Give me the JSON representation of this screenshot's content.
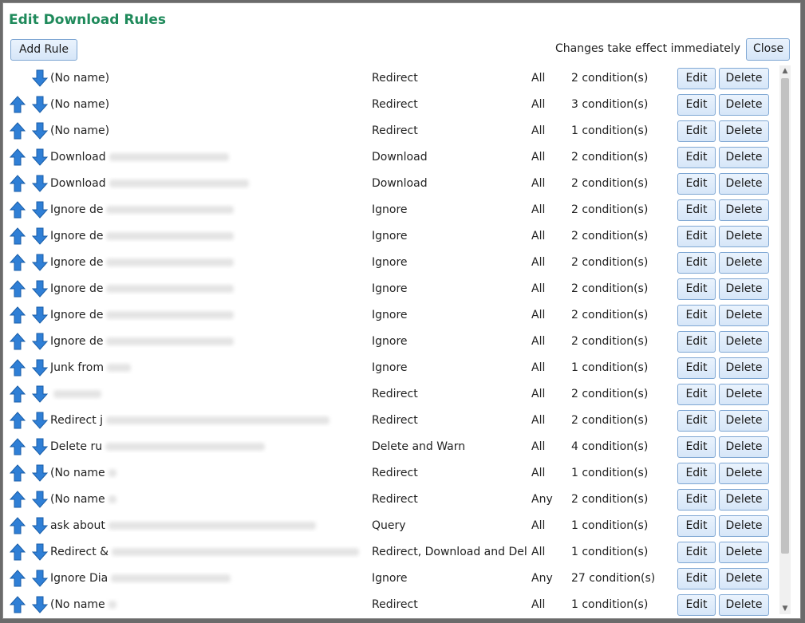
{
  "dialog": {
    "title": "Edit Download Rules",
    "add_rule_label": "Add Rule",
    "note": "Changes take effect immediately",
    "close_label": "Close"
  },
  "buttons": {
    "edit": "Edit",
    "delete": "Delete"
  },
  "rules": [
    {
      "name": "(No name)",
      "action": "Redirect",
      "match": "All",
      "conditions": "2 condition(s)",
      "up": false
    },
    {
      "name": "(No name)",
      "action": "Redirect",
      "match": "All",
      "conditions": "3 condition(s)",
      "up": true
    },
    {
      "name": "(No name)",
      "action": "Redirect",
      "match": "All",
      "conditions": "1 condition(s)",
      "up": true
    },
    {
      "name": "Download",
      "action": "Download",
      "match": "All",
      "conditions": "2 condition(s)",
      "up": true
    },
    {
      "name": "Download",
      "action": "Download",
      "match": "All",
      "conditions": "2 condition(s)",
      "up": true
    },
    {
      "name": "Ignore de",
      "action": "Ignore",
      "match": "All",
      "conditions": "2 condition(s)",
      "up": true
    },
    {
      "name": "Ignore de",
      "action": "Ignore",
      "match": "All",
      "conditions": "2 condition(s)",
      "up": true
    },
    {
      "name": "Ignore de",
      "action": "Ignore",
      "match": "All",
      "conditions": "2 condition(s)",
      "up": true
    },
    {
      "name": "Ignore de",
      "action": "Ignore",
      "match": "All",
      "conditions": "2 condition(s)",
      "up": true
    },
    {
      "name": "Ignore de",
      "action": "Ignore",
      "match": "All",
      "conditions": "2 condition(s)",
      "up": true
    },
    {
      "name": "Ignore de",
      "action": "Ignore",
      "match": "All",
      "conditions": "2 condition(s)",
      "up": true
    },
    {
      "name": "Junk from",
      "action": "Ignore",
      "match": "All",
      "conditions": "1 condition(s)",
      "up": true
    },
    {
      "name": "",
      "action": "Redirect",
      "match": "All",
      "conditions": "2 condition(s)",
      "up": true
    },
    {
      "name": "Redirect j",
      "action": "Redirect",
      "match": "All",
      "conditions": "2 condition(s)",
      "up": true
    },
    {
      "name": "Delete ru",
      "action": "Delete and Warn",
      "match": "All",
      "conditions": "4 condition(s)",
      "up": true
    },
    {
      "name": "(No name",
      "action": "Redirect",
      "match": "All",
      "conditions": "1 condition(s)",
      "up": true
    },
    {
      "name": "(No name",
      "action": "Redirect",
      "match": "Any",
      "conditions": "2 condition(s)",
      "up": true
    },
    {
      "name": "ask about",
      "action": "Query",
      "match": "All",
      "conditions": "1 condition(s)",
      "up": true
    },
    {
      "name": "Redirect &",
      "action": "Redirect, Download and Del",
      "match": "All",
      "conditions": "1 condition(s)",
      "up": true
    },
    {
      "name": "Ignore Dia",
      "action": "Ignore",
      "match": "Any",
      "conditions": "27 condition(s)",
      "up": true
    },
    {
      "name": "(No name",
      "action": "Redirect",
      "match": "All",
      "conditions": "1 condition(s)",
      "up": true
    }
  ],
  "icons": {
    "up": "arrow-up-icon",
    "down": "arrow-down-icon"
  },
  "colors": {
    "title": "#1f8a5b",
    "arrow": "#2f7fd6",
    "button_border": "#7fa7d3"
  }
}
